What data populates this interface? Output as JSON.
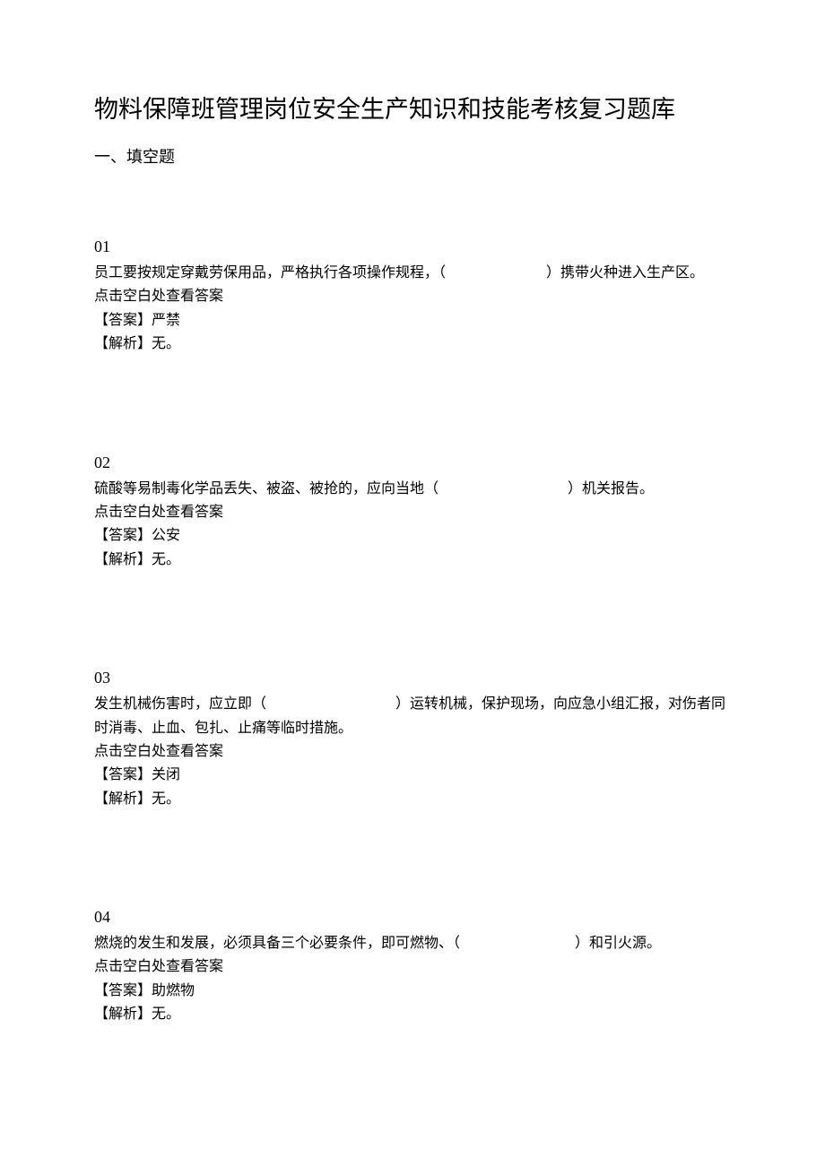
{
  "title": "物料保障班管理岗位安全生产知识和技能考核复习题库",
  "section_header": "一、填空题",
  "questions": [
    {
      "number": "01",
      "text": "员工要按规定穿戴劳保用品，严格执行各项操作规程，（　　　　　　　）携带火种进入生产区。",
      "hint": "点击空白处查看答案",
      "answer": "【答案】严禁",
      "explain": "【解析】无。"
    },
    {
      "number": "02",
      "text": "硫酸等易制毒化学品丢失、被盗、被抢的，应向当地（　　　　　　　　　）机关报告。",
      "hint": "点击空白处查看答案",
      "answer": "【答案】公安",
      "explain": "【解析】无。"
    },
    {
      "number": "03",
      "text": "发生机械伤害时，应立即（　　　　　　　　　）运转机械，保护现场，向应急小组汇报，对伤者同时消毒、止血、包扎、止痛等临时措施。",
      "hint": "点击空白处查看答案",
      "answer": "【答案】关闭",
      "explain": "【解析】无。"
    },
    {
      "number": "04",
      "text": "燃烧的发生和发展，必须具备三个必要条件，即可燃物、（　　　　　　　　）和引火源。",
      "hint": "点击空白处查看答案",
      "answer": "【答案】助燃物",
      "explain": "【解析】无。"
    }
  ]
}
